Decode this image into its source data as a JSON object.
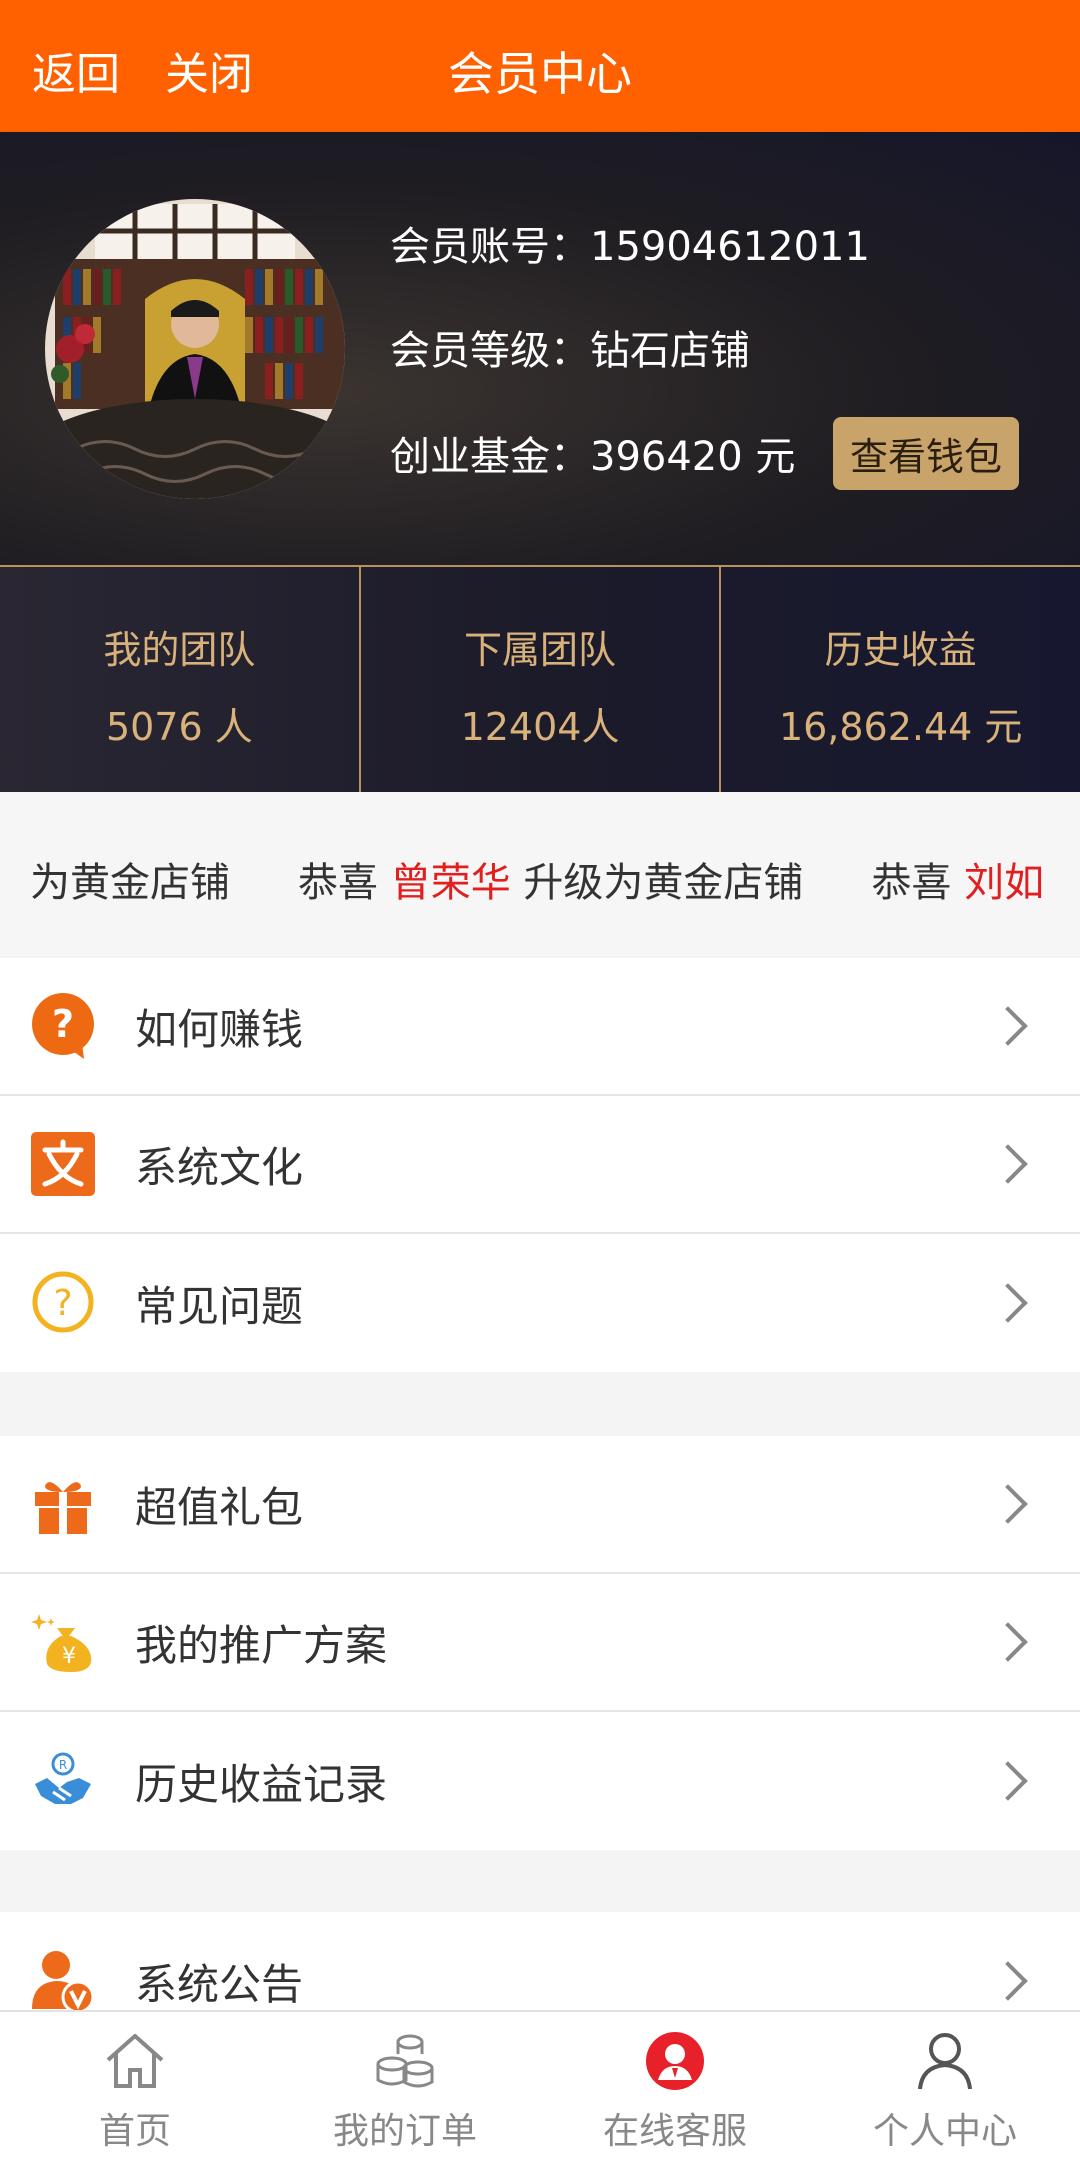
{
  "topbar": {
    "back_label": "返回",
    "close_label": "关闭",
    "title": "会员中心",
    "background": "#ff6000"
  },
  "profile": {
    "account_label": "会员账号：",
    "account_value": "15904612011",
    "level_label": "会员等级：",
    "level_value": "钻石店铺",
    "fund_label": "创业基金：",
    "fund_value": "396420 元",
    "wallet_button": "查看钱包"
  },
  "stats": [
    {
      "label": "我的团队",
      "value": "5076 人"
    },
    {
      "label": "下属团队",
      "value": "12404人"
    },
    {
      "label": "历史收益",
      "value": "16,862.44 元"
    }
  ],
  "marquee": {
    "segment1": "为黄金店铺",
    "segment2_prefix": "恭喜 ",
    "segment2_name": "曾荣华",
    "segment2_suffix": " 升级为黄金店铺",
    "segment3_prefix": "恭喜 ",
    "segment3_name": "刘如"
  },
  "menu_group_1": [
    {
      "label": "如何赚钱",
      "icon": "question-bubble-icon"
    },
    {
      "label": "系统文化",
      "icon": "text-wen-icon"
    },
    {
      "label": "常见问题",
      "icon": "question-circle-icon"
    }
  ],
  "menu_group_2": [
    {
      "label": "超值礼包",
      "icon": "gift-icon"
    },
    {
      "label": "我的推广方案",
      "icon": "money-bag-icon"
    },
    {
      "label": "历史收益记录",
      "icon": "handshake-icon"
    }
  ],
  "menu_group_3": [
    {
      "label": "系统公告",
      "icon": "user-v-icon"
    }
  ],
  "bottom_nav": [
    {
      "label": "首页",
      "icon": "home-icon"
    },
    {
      "label": "我的订单",
      "icon": "coins-icon"
    },
    {
      "label": "在线客服",
      "icon": "customer-service-icon"
    },
    {
      "label": "个人中心",
      "icon": "person-icon"
    }
  ],
  "colors": {
    "accent": "#ff6000",
    "gold": "#c9a46a",
    "highlight_red": "#e02020"
  }
}
